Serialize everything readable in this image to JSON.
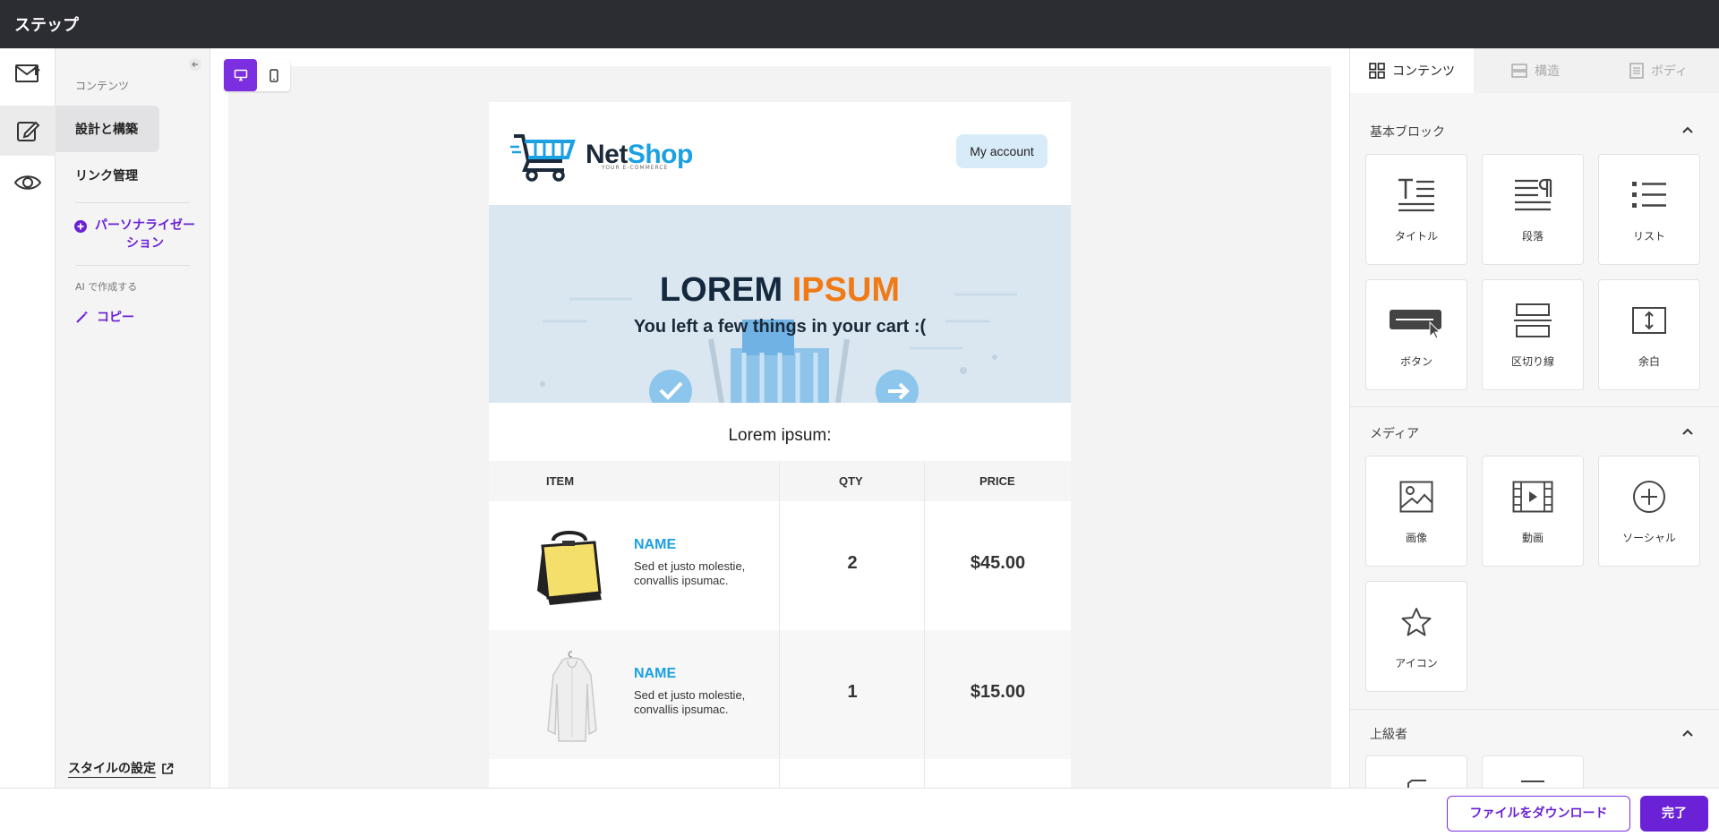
{
  "app": {
    "title": "ステップ"
  },
  "nav": {
    "content_section": "コンテンツ",
    "design_build": "設計と構築",
    "link_manage": "リンク管理",
    "personalization": "パーソナライゼーション",
    "ai_section": "AI で作成する",
    "copy": "コピー",
    "style_settings": "スタイルの設定"
  },
  "email": {
    "brand": {
      "name_part1": "Net",
      "name_part2": "Shop",
      "tagline": "YOUR E-COMMERCE"
    },
    "account_button": "My account",
    "hero": {
      "title_dark": "LOREM",
      "title_orange": "IPSUM",
      "subtitle": "You left a few things in your cart :("
    },
    "section_title": "Lorem ipsum:",
    "table": {
      "headers": [
        "ITEM",
        "QTY",
        "PRICE"
      ],
      "rows": [
        {
          "name": "NAME",
          "desc": "Sed et justo molestie, convallis ipsumac.",
          "qty": "2",
          "price": "$45.00"
        },
        {
          "name": "NAME",
          "desc": "Sed et justo molestie, convallis ipsumac.",
          "qty": "1",
          "price": "$15.00"
        }
      ]
    }
  },
  "panel": {
    "tabs": [
      "コンテンツ",
      "構造",
      "ボディ"
    ],
    "groups": [
      {
        "title": "基本ブロック",
        "items": [
          "タイトル",
          "段落",
          "リスト",
          "ボタン",
          "区切り線",
          "余白"
        ]
      },
      {
        "title": "メディア",
        "items": [
          "画像",
          "動画",
          "ソーシャル",
          "アイコン"
        ]
      },
      {
        "title": "上級者",
        "items": []
      }
    ]
  },
  "footer": {
    "download": "ファイルをダウンロード",
    "done": "完了"
  },
  "colors": {
    "accent": "#6b21d6",
    "topbar": "#2c2c33",
    "brand_blue": "#1aa0e3",
    "hero_orange": "#f07a16"
  }
}
